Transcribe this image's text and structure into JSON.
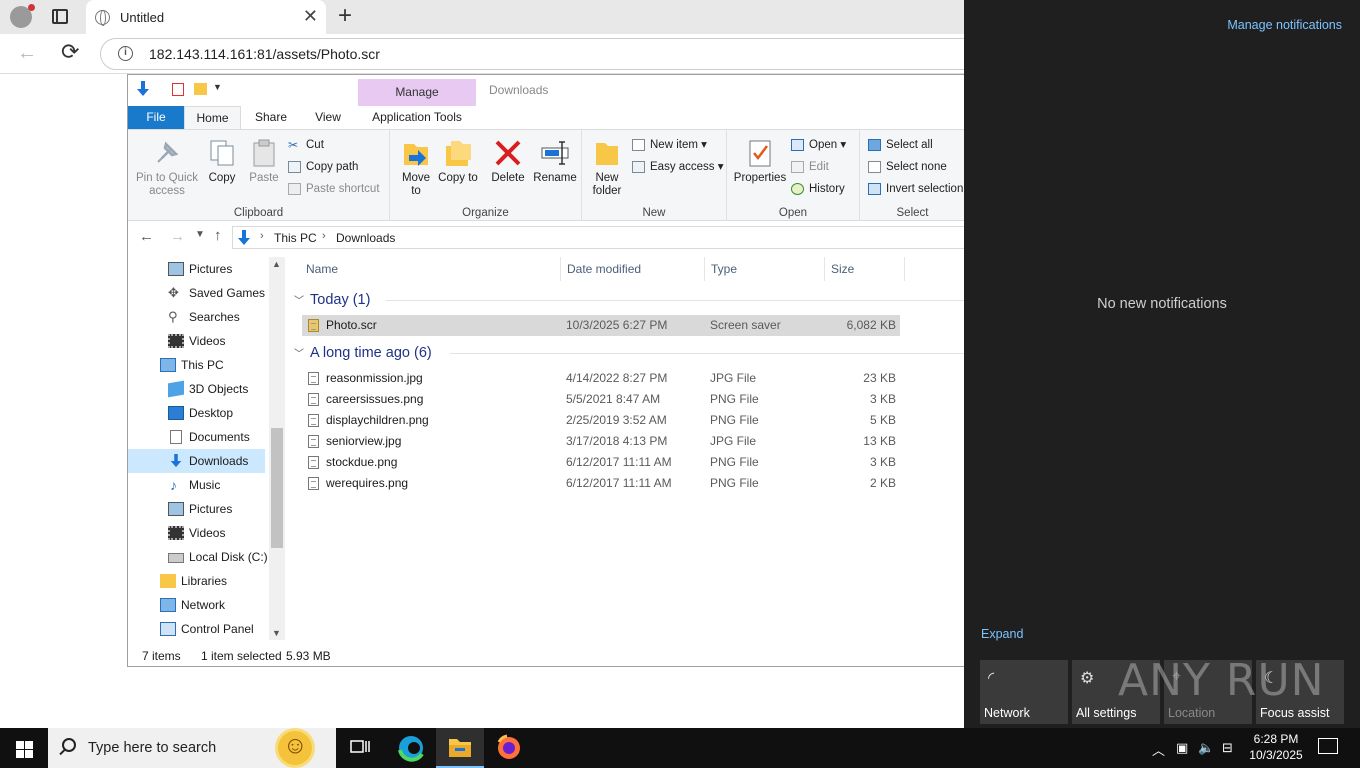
{
  "browser": {
    "tab_title": "Untitled",
    "tab_close": "✕",
    "new_tab": "+",
    "url": "182.143.114.161:81/assets/Photo.scr",
    "back": "←",
    "reload": "⟳",
    "info": "i"
  },
  "explorer": {
    "manage_label": "Manage",
    "window_title": "Downloads",
    "tabs": [
      "File",
      "Home",
      "Share",
      "View",
      "Application Tools"
    ],
    "ribbon": {
      "clipboard": {
        "pin": "Pin to Quick access",
        "copy": "Copy",
        "paste": "Paste",
        "cut": "Cut",
        "copy_path": "Copy path",
        "paste_shortcut": "Paste shortcut",
        "label": "Clipboard"
      },
      "organize": {
        "move_to": "Move to",
        "copy_to": "Copy to",
        "delete": "Delete",
        "rename": "Rename",
        "label": "Organize"
      },
      "new": {
        "new_folder": "New folder",
        "new_item": "New item",
        "easy_access": "Easy access",
        "label": "New"
      },
      "open": {
        "properties": "Properties",
        "open": "Open",
        "edit": "Edit",
        "history": "History",
        "label": "Open"
      },
      "select": {
        "select_all": "Select all",
        "select_none": "Select none",
        "invert": "Invert selection",
        "label": "Select"
      }
    },
    "address": {
      "crumbs": [
        "This PC",
        "Downloads"
      ]
    },
    "nav": [
      {
        "label": "Pictures"
      },
      {
        "label": "Saved Games"
      },
      {
        "label": "Searches"
      },
      {
        "label": "Videos"
      },
      {
        "label": "This PC"
      },
      {
        "label": "3D Objects"
      },
      {
        "label": "Desktop"
      },
      {
        "label": "Documents"
      },
      {
        "label": "Downloads"
      },
      {
        "label": "Music"
      },
      {
        "label": "Pictures"
      },
      {
        "label": "Videos"
      },
      {
        "label": "Local Disk (C:)"
      },
      {
        "label": "Libraries"
      },
      {
        "label": "Network"
      },
      {
        "label": "Control Panel"
      }
    ],
    "columns": [
      "Name",
      "Date modified",
      "Type",
      "Size"
    ],
    "groups": [
      {
        "title": "Today (1)",
        "files": [
          {
            "name": "Photo.scr",
            "date": "10/3/2025 6:27 PM",
            "type": "Screen saver",
            "size": "6,082 KB"
          }
        ]
      },
      {
        "title": "A long time ago (6)",
        "files": [
          {
            "name": "reasonmission.jpg",
            "date": "4/14/2022 8:27 PM",
            "type": "JPG File",
            "size": "23 KB"
          },
          {
            "name": "careersissues.png",
            "date": "5/5/2021 8:47 AM",
            "type": "PNG File",
            "size": "3 KB"
          },
          {
            "name": "displaychildren.png",
            "date": "2/25/2019 3:52 AM",
            "type": "PNG File",
            "size": "5 KB"
          },
          {
            "name": "seniorview.jpg",
            "date": "3/17/2018 4:13 PM",
            "type": "JPG File",
            "size": "13 KB"
          },
          {
            "name": "stockdue.png",
            "date": "6/12/2017 11:11 AM",
            "type": "PNG File",
            "size": "3 KB"
          },
          {
            "name": "werequires.png",
            "date": "6/12/2017 11:11 AM",
            "type": "PNG File",
            "size": "2 KB"
          }
        ]
      }
    ],
    "status": {
      "items": "7 items",
      "selected": "1 item selected",
      "size": "5.93 MB"
    }
  },
  "action_center": {
    "manage": "Manage notifications",
    "empty": "No new notifications",
    "expand": "Expand",
    "quick_actions": [
      "Network",
      "All settings",
      "Location",
      "Focus assist"
    ]
  },
  "watermark": "ANY RUN",
  "taskbar": {
    "search_placeholder": "Type here to search",
    "time": "6:28 PM",
    "date": "10/3/2025"
  },
  "colors": {
    "file_tab": "#1979ca",
    "manage_tab": "#e7c9f1",
    "link": "#7cc3ff",
    "selection": "#cce8ff"
  }
}
